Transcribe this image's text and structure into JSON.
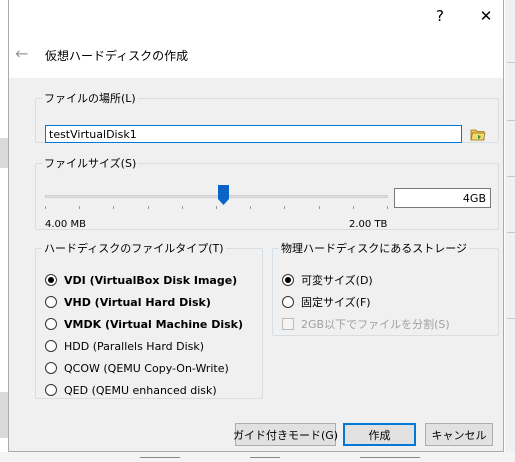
{
  "titlebar": {
    "help_label": "?",
    "close_label": "✕"
  },
  "header": {
    "back_label": "←",
    "title": "仮想ハードディスクの作成"
  },
  "location": {
    "legend": "ファイルの場所(L)",
    "value": "testVirtualDisk1",
    "folder_icon": "folder-icon"
  },
  "size": {
    "legend": "ファイルサイズ(S)",
    "value": "4GB",
    "min_label": "4.00 MB",
    "max_label": "2.00 TB",
    "slider_position_fraction": 0.52
  },
  "file_type": {
    "legend": "ハードディスクのファイルタイプ(T)",
    "options": [
      {
        "label": "VDI (VirtualBox Disk Image)",
        "checked": true,
        "bold": true
      },
      {
        "label": "VHD (Virtual Hard Disk)",
        "checked": false,
        "bold": true
      },
      {
        "label": "VMDK (Virtual Machine Disk)",
        "checked": false,
        "bold": true
      },
      {
        "label": "HDD (Parallels Hard Disk)",
        "checked": false,
        "bold": false
      },
      {
        "label": "QCOW (QEMU Copy-On-Write)",
        "checked": false,
        "bold": false
      },
      {
        "label": "QED (QEMU enhanced disk)",
        "checked": false,
        "bold": false
      }
    ]
  },
  "storage": {
    "legend": "物理ハードディスクにあるストレージ",
    "dynamic_label": "可変サイズ(D)",
    "fixed_label": "固定サイズ(F)",
    "split_label": "2GB以下でファイルを分割(S)"
  },
  "buttons": {
    "guided": "ガイド付きモード(G)",
    "create": "作成",
    "cancel": "キャンセル"
  },
  "colors": {
    "accent": "#0078d7",
    "slider_thumb": "#0a64c8"
  }
}
